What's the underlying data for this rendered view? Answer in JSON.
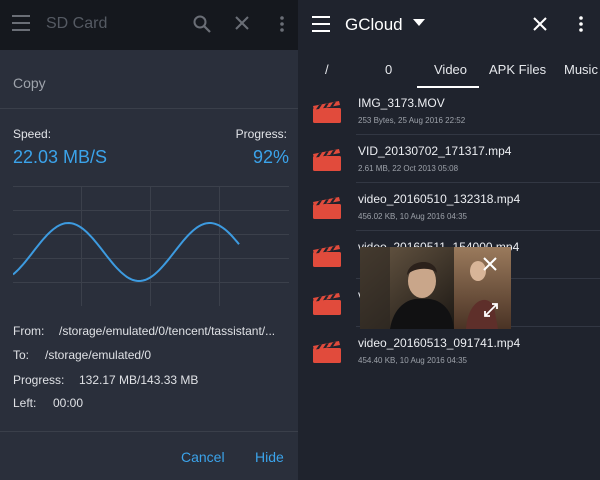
{
  "left": {
    "toolbar_title": "SD Card",
    "dialog": {
      "title": "Copy",
      "speed_label": "Speed:",
      "speed_value": "22.03 MB/S",
      "progress_label": "Progress:",
      "progress_value": "92%",
      "from_label": "From:",
      "from_value": "/storage/emulated/0/tencent/tassistant/...",
      "to_label": "To:",
      "to_value": "/storage/emulated/0",
      "progress_size_label": "Progress:",
      "progress_size_value": "132.17 MB/143.33 MB",
      "left_label": "Left:",
      "left_value": "00:00",
      "cancel_label": "Cancel",
      "hide_label": "Hide"
    }
  },
  "right": {
    "toolbar_title": "GCloud",
    "tabs": [
      "/",
      "0",
      "Video",
      "APK Files",
      "Music"
    ],
    "active_tab": "Video",
    "files": [
      {
        "name": "IMG_3173.MOV",
        "meta": "253 Bytes, 25 Aug 2016 22:52"
      },
      {
        "name": "VID_20130702_171317.mp4",
        "meta": "2.61 MB, 22 Oct 2013 05:08"
      },
      {
        "name": "video_20160510_132318.mp4",
        "meta": "456.02 KB, 10 Aug 2016 04:35"
      },
      {
        "name": "video_20160511_154000.mp4",
        "meta": ""
      },
      {
        "name": "video_20160512_1",
        "meta": ""
      },
      {
        "name": "video_20160513_091741.mp4",
        "meta": "454.40 KB, 10 Aug 2016 04:35"
      }
    ]
  },
  "icons": {
    "menu": "menu-icon",
    "search": "search-icon",
    "close": "close-icon",
    "more": "more-vert-icon",
    "dropdown": "arrow-drop-down-icon",
    "video_file": "video-file-icon",
    "fullscreen": "fullscreen-icon"
  },
  "colors": {
    "accent": "#3ba3ea",
    "file_icon": "#e14b3c",
    "graph_line": "#3d9be0"
  }
}
